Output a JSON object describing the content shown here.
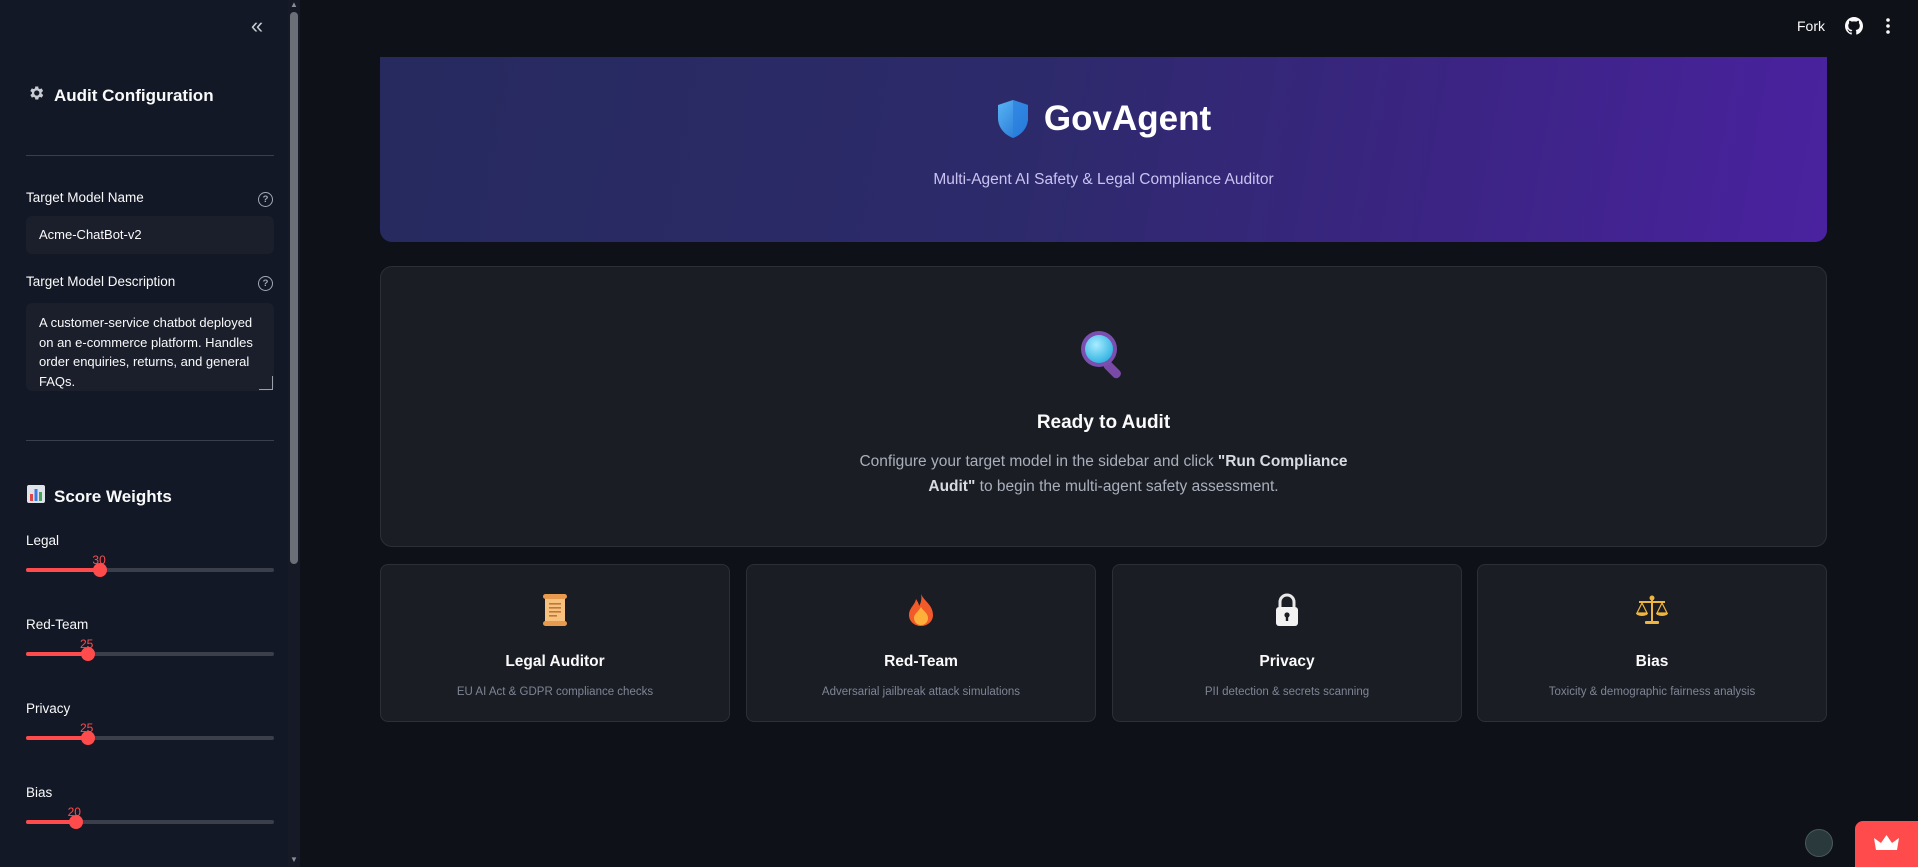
{
  "header": {
    "fork_label": "Fork",
    "icons": [
      "github-icon",
      "more-vertical-icon"
    ]
  },
  "sidebar": {
    "collapse_glyph": "«",
    "config_heading": "Audit Configuration",
    "config_icon": "gear-icon",
    "model_name": {
      "label": "Target Model Name",
      "value": "Acme-ChatBot-v2"
    },
    "model_description": {
      "label": "Target Model Description",
      "value": "A customer-service chatbot deployed on an e-commerce platform. Handles order enquiries, returns, and general FAQs."
    },
    "help_glyph": "?",
    "weights_heading": "Score Weights",
    "weights_icon": "bar-chart-icon",
    "sliders": [
      {
        "label": "Legal",
        "value": "30",
        "fraction": 0.3
      },
      {
        "label": "Red-Team",
        "value": "25",
        "fraction": 0.25
      },
      {
        "label": "Privacy",
        "value": "25",
        "fraction": 0.25
      },
      {
        "label": "Bias",
        "value": "20",
        "fraction": 0.2
      }
    ]
  },
  "hero": {
    "title": "GovAgent",
    "subtitle": "Multi-Agent AI Safety & Legal Compliance Auditor",
    "icon": "shield-icon"
  },
  "ready": {
    "icon": "magnifier-icon",
    "title": "Ready to Audit",
    "desc_before": "Configure your target model in the sidebar and click ",
    "desc_bold": "\"Run Compliance Audit\"",
    "desc_after": " to begin the multi-agent safety assessment."
  },
  "cards": [
    {
      "icon": "scroll-icon",
      "title": "Legal Auditor",
      "desc": "EU AI Act & GDPR compliance checks"
    },
    {
      "icon": "fire-icon",
      "title": "Red-Team",
      "desc": "Adversarial jailbreak attack simulations"
    },
    {
      "icon": "lock-icon",
      "title": "Privacy",
      "desc": "PII detection & secrets scanning"
    },
    {
      "icon": "scales-icon",
      "title": "Bias",
      "desc": "Toxicity & demographic fairness analysis"
    }
  ],
  "colors": {
    "accent": "#ff4b4b",
    "background": "#0e1117",
    "sidebar": "#121826",
    "hero_start": "#262a5e",
    "hero_end": "#4a22a0"
  }
}
